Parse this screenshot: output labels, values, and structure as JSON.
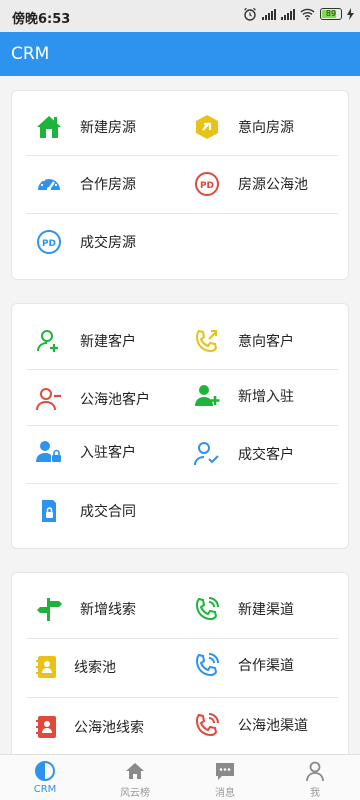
{
  "status": {
    "time": "傍晚6:53",
    "battery": "89"
  },
  "appbar": {
    "title": "CRM"
  },
  "cards": [
    {
      "items": [
        {
          "label": "新建房源",
          "icon": "house-icon",
          "color": "#1eb43c"
        },
        {
          "label": "意向房源",
          "icon": "intent-icon",
          "color": "#e8c21a"
        },
        {
          "label": "合作房源",
          "icon": "gauge-icon",
          "color": "#2e93ef"
        },
        {
          "label": "房源公海池",
          "icon": "pd-red-icon",
          "color": "#e04a3c"
        },
        {
          "label": "成交房源",
          "icon": "pd-blue-icon",
          "color": "#2e93ef"
        }
      ]
    },
    {
      "items": [
        {
          "label": "新建客户",
          "icon": "user-add-icon",
          "color": "#1eb43c"
        },
        {
          "label": "意向客户",
          "icon": "phone-out-icon",
          "color": "#e8c21a"
        },
        {
          "label": "公海池客户",
          "icon": "user-minus-icon",
          "color": "#e04a3c"
        },
        {
          "label": "新增入驻",
          "icon": "user-plus-filled-icon",
          "color": "#1eb43c"
        },
        {
          "label": "入驻客户",
          "icon": "user-lock-icon",
          "color": "#2e93ef"
        },
        {
          "label": "成交客户",
          "icon": "user-check-icon",
          "color": "#2e93ef"
        },
        {
          "label": "成交合同",
          "icon": "contract-lock-icon",
          "color": "#2e93ef"
        }
      ]
    },
    {
      "items": [
        {
          "label": "新增线索",
          "icon": "signpost-icon",
          "color": "#1eb43c"
        },
        {
          "label": "新建渠道",
          "icon": "phone-ring-icon",
          "color": "#1eb43c"
        },
        {
          "label": "线索池",
          "icon": "contacts-icon",
          "color": "#e8c21a"
        },
        {
          "label": "合作渠道",
          "icon": "phone-ring-icon",
          "color": "#2e93ef"
        },
        {
          "label": "公海池线索",
          "icon": "contacts-icon",
          "color": "#e04a3c"
        },
        {
          "label": "公海池渠道",
          "icon": "phone-ring-icon",
          "color": "#e04a3c"
        }
      ]
    }
  ],
  "tabs": [
    {
      "label": "CRM",
      "active": true
    },
    {
      "label": "风云榜",
      "active": false
    },
    {
      "label": "消息",
      "active": false
    },
    {
      "label": "我",
      "active": false
    }
  ]
}
